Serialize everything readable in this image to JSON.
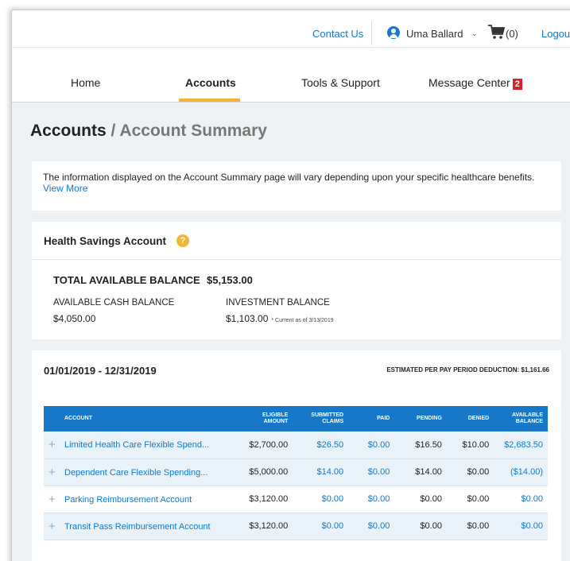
{
  "header": {
    "contact_us": "Contact Us",
    "user_name": "Uma Ballard",
    "cart_count": "(0)",
    "logout": "Logout"
  },
  "nav": {
    "home": "Home",
    "accounts": "Accounts",
    "tools": "Tools & Support",
    "message_center": "Message Center",
    "message_badge": "2",
    "active": "accounts"
  },
  "page": {
    "title": "Accounts",
    "separator": " / ",
    "crumb": "Account Summary"
  },
  "info": {
    "text": "The information displayed on the Account Summary page will vary depending upon your specific healthcare benefits.",
    "view_more": "View More"
  },
  "hsa": {
    "title": "Health Savings Account",
    "help_icon": "?",
    "total_label": "TOTAL AVAILABLE BALANCE",
    "total_value": "$5,153.00",
    "cash_label": "AVAILABLE CASH BALANCE",
    "cash_value": "$4,050.00",
    "investment_label": "INVESTMENT BALANCE",
    "investment_value": "$1,103.00",
    "investment_note": "* Current as of 3/13/2019"
  },
  "plan": {
    "period": "01/01/2019 - 12/31/2019",
    "estimated": "ESTIMATED PER PAY PERIOD DEDUCTION: $1,161.66",
    "columns": {
      "account": "ACCOUNT",
      "eligible_1": "ELIGIBLE",
      "eligible_2": "AMOUNT",
      "submitted_1": "SUBMITTED",
      "submitted_2": "CLAIMS",
      "paid": "PAID",
      "pending": "PENDING",
      "denied": "DENIED",
      "available_1": "AVAILABLE",
      "available_2": "BALANCE"
    },
    "rows": [
      {
        "account": "Limited Health Care Flexible Spend...",
        "eligible": "$2,700.00",
        "submitted": "$26.50",
        "paid": "$0.00",
        "pending": "$16.50",
        "denied": "$10.00",
        "available": "$2,683.50"
      },
      {
        "account": "Dependent Care Flexible Spending...",
        "eligible": "$5,000.00",
        "submitted": "$14.00",
        "paid": "$0.00",
        "pending": "$14.00",
        "denied": "$0.00",
        "available": "($14.00)"
      },
      {
        "account": "Parking Reimbursement Account",
        "eligible": "$3,120.00",
        "submitted": "$0.00",
        "paid": "$0.00",
        "pending": "$0.00",
        "denied": "$0.00",
        "available": "$0.00"
      },
      {
        "account": "Transit Pass Reimbursement Account",
        "eligible": "$3,120.00",
        "submitted": "$0.00",
        "paid": "$0.00",
        "pending": "$0.00",
        "denied": "$0.00",
        "available": "$0.00"
      }
    ]
  },
  "colors": {
    "link": "#1478c8",
    "header_blue": "#1777c9",
    "accent_yellow": "#f2b533",
    "badge_red": "#d6202c",
    "page_bg": "#eef2f5"
  }
}
